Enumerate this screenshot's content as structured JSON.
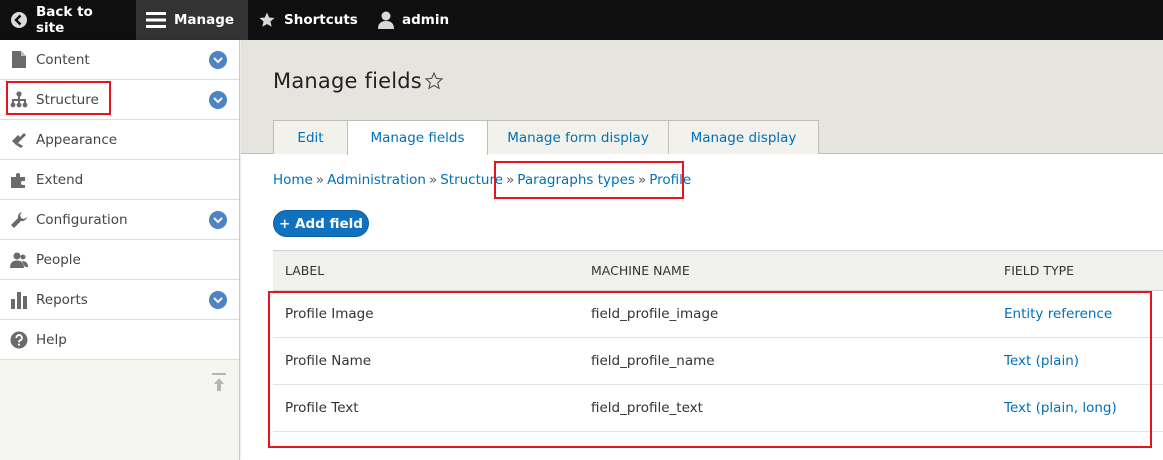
{
  "toolbar": {
    "back_label": "Back to site",
    "manage_label": "Manage",
    "shortcuts_label": "Shortcuts",
    "user_label": "admin"
  },
  "sidebar": {
    "items": [
      {
        "label": "Content",
        "icon": "file-icon",
        "has_children": true
      },
      {
        "label": "Structure",
        "icon": "sitemap-icon",
        "has_children": true
      },
      {
        "label": "Appearance",
        "icon": "brush-icon",
        "has_children": false
      },
      {
        "label": "Extend",
        "icon": "puzzle-icon",
        "has_children": false
      },
      {
        "label": "Configuration",
        "icon": "wrench-icon",
        "has_children": true
      },
      {
        "label": "People",
        "icon": "people-icon",
        "has_children": false
      },
      {
        "label": "Reports",
        "icon": "bar-chart-icon",
        "has_children": true
      },
      {
        "label": "Help",
        "icon": "help-icon",
        "has_children": false
      }
    ]
  },
  "page": {
    "title": "Manage fields",
    "tabs": [
      {
        "label": "Edit",
        "active": false
      },
      {
        "label": "Manage fields",
        "active": true
      },
      {
        "label": "Manage form display",
        "active": false
      },
      {
        "label": "Manage display",
        "active": false
      }
    ],
    "breadcrumb": [
      "Home",
      "Administration",
      "Structure",
      "Paragraphs types",
      "Profile"
    ],
    "breadcrumb_separator": "»",
    "add_button": "+ Add field"
  },
  "table": {
    "headers": [
      "LABEL",
      "MACHINE NAME",
      "FIELD TYPE"
    ],
    "rows": [
      {
        "label": "Profile Image",
        "machine_name": "field_profile_image",
        "field_type": "Entity reference"
      },
      {
        "label": "Profile Name",
        "machine_name": "field_profile_name",
        "field_type": "Text (plain)"
      },
      {
        "label": "Profile Text",
        "machine_name": "field_profile_text",
        "field_type": "Text (plain, long)"
      }
    ]
  },
  "colors": {
    "link": "#0071b8",
    "toolbar_bg": "#0f0f0f",
    "highlight": "#e8131c",
    "button": "#0e72c1"
  }
}
